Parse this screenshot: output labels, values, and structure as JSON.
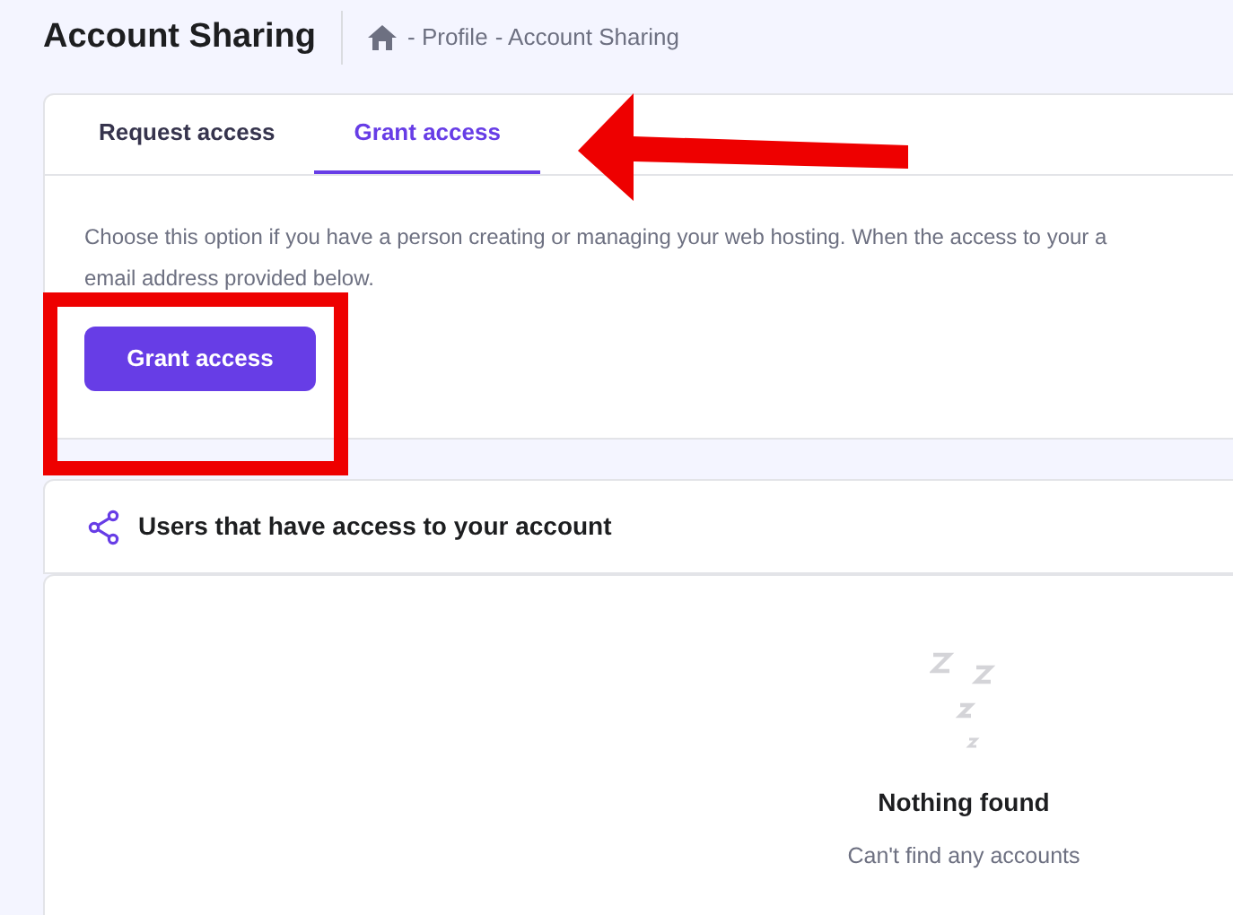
{
  "header": {
    "title": "Account Sharing",
    "breadcrumb": [
      "- Profile",
      "- Account Sharing"
    ]
  },
  "tabs": [
    {
      "label": "Request access",
      "selected": false
    },
    {
      "label": "Grant access",
      "selected": true
    }
  ],
  "description": [
    "Choose this option if you have a person creating or managing your web hosting. When the access to your a",
    "email address provided below."
  ],
  "grant_button": "Grant access",
  "users_section": {
    "title": "Users that have access to your account",
    "empty_title": "Nothing found",
    "empty_text": "Can't find any accounts"
  }
}
